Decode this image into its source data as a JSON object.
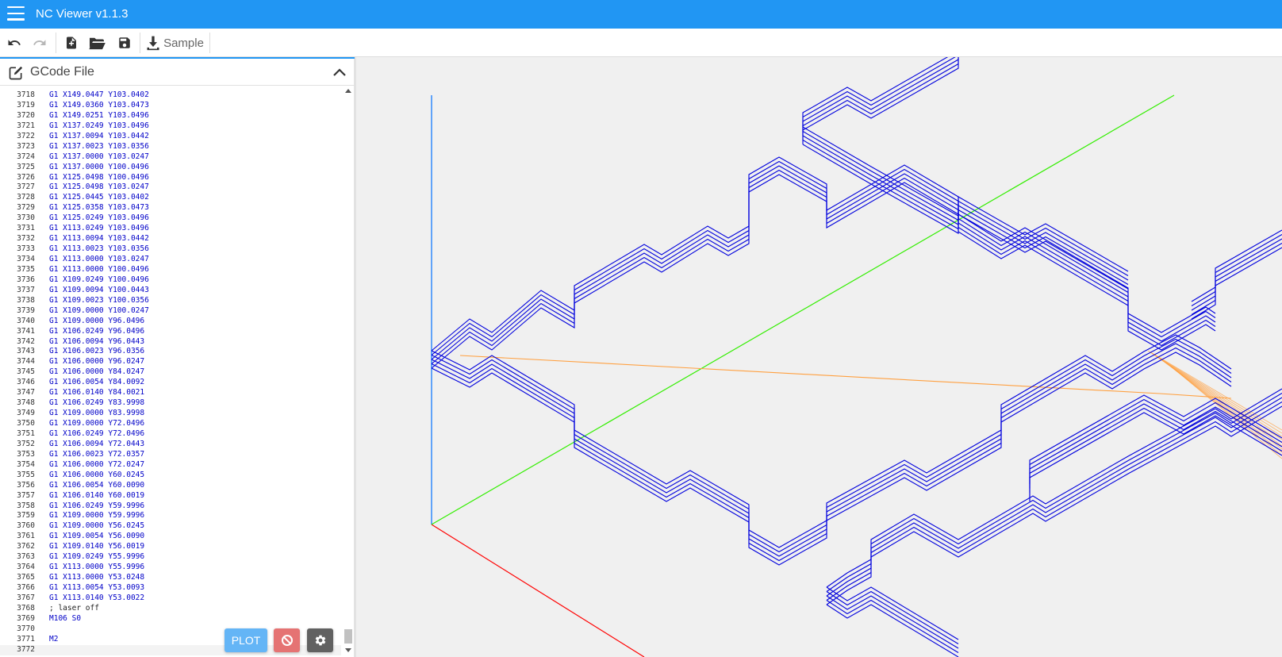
{
  "app": {
    "title": "NC Viewer  v1.1.3"
  },
  "toolbar": {
    "sample_label": "Sample",
    "icons": [
      "undo-icon",
      "redo-icon",
      "new-file-icon",
      "open-folder-icon",
      "save-icon",
      "download-icon"
    ]
  },
  "panel": {
    "title": "GCode File"
  },
  "editor": {
    "lines": [
      {
        "n": "3718",
        "code": "G1 X149.0447 Y103.0402"
      },
      {
        "n": "3719",
        "code": "G1 X149.0360 Y103.0473"
      },
      {
        "n": "3720",
        "code": "G1 X149.0251 Y103.0496"
      },
      {
        "n": "3721",
        "code": "G1 X137.0249 Y103.0496"
      },
      {
        "n": "3722",
        "code": "G1 X137.0094 Y103.0442"
      },
      {
        "n": "3723",
        "code": "G1 X137.0023 Y103.0356"
      },
      {
        "n": "3724",
        "code": "G1 X137.0000 Y103.0247"
      },
      {
        "n": "3725",
        "code": "G1 X137.0000 Y100.0496"
      },
      {
        "n": "3726",
        "code": "G1 X125.0498 Y100.0496"
      },
      {
        "n": "3727",
        "code": "G1 X125.0498 Y103.0247"
      },
      {
        "n": "3728",
        "code": "G1 X125.0445 Y103.0402"
      },
      {
        "n": "3729",
        "code": "G1 X125.0358 Y103.0473"
      },
      {
        "n": "3730",
        "code": "G1 X125.0249 Y103.0496"
      },
      {
        "n": "3731",
        "code": "G1 X113.0249 Y103.0496"
      },
      {
        "n": "3732",
        "code": "G1 X113.0094 Y103.0442"
      },
      {
        "n": "3733",
        "code": "G1 X113.0023 Y103.0356"
      },
      {
        "n": "3734",
        "code": "G1 X113.0000 Y103.0247"
      },
      {
        "n": "3735",
        "code": "G1 X113.0000 Y100.0496"
      },
      {
        "n": "3736",
        "code": "G1 X109.0249 Y100.0496"
      },
      {
        "n": "3737",
        "code": "G1 X109.0094 Y100.0443"
      },
      {
        "n": "3738",
        "code": "G1 X109.0023 Y100.0356"
      },
      {
        "n": "3739",
        "code": "G1 X109.0000 Y100.0247"
      },
      {
        "n": "3740",
        "code": "G1 X109.0000 Y96.0496"
      },
      {
        "n": "3741",
        "code": "G1 X106.0249 Y96.0496"
      },
      {
        "n": "3742",
        "code": "G1 X106.0094 Y96.0443"
      },
      {
        "n": "3743",
        "code": "G1 X106.0023 Y96.0356"
      },
      {
        "n": "3744",
        "code": "G1 X106.0000 Y96.0247"
      },
      {
        "n": "3745",
        "code": "G1 X106.0000 Y84.0247"
      },
      {
        "n": "3746",
        "code": "G1 X106.0054 Y84.0092"
      },
      {
        "n": "3747",
        "code": "G1 X106.0140 Y84.0021"
      },
      {
        "n": "3748",
        "code": "G1 X106.0249 Y83.9998"
      },
      {
        "n": "3749",
        "code": "G1 X109.0000 Y83.9998"
      },
      {
        "n": "3750",
        "code": "G1 X109.0000 Y72.0496"
      },
      {
        "n": "3751",
        "code": "G1 X106.0249 Y72.0496"
      },
      {
        "n": "3752",
        "code": "G1 X106.0094 Y72.0443"
      },
      {
        "n": "3753",
        "code": "G1 X106.0023 Y72.0357"
      },
      {
        "n": "3754",
        "code": "G1 X106.0000 Y72.0247"
      },
      {
        "n": "3755",
        "code": "G1 X106.0000 Y60.0245"
      },
      {
        "n": "3756",
        "code": "G1 X106.0054 Y60.0090"
      },
      {
        "n": "3757",
        "code": "G1 X106.0140 Y60.0019"
      },
      {
        "n": "3758",
        "code": "G1 X106.0249 Y59.9996"
      },
      {
        "n": "3759",
        "code": "G1 X109.0000 Y59.9996"
      },
      {
        "n": "3760",
        "code": "G1 X109.0000 Y56.0245"
      },
      {
        "n": "3761",
        "code": "G1 X109.0054 Y56.0090"
      },
      {
        "n": "3762",
        "code": "G1 X109.0140 Y56.0019"
      },
      {
        "n": "3763",
        "code": "G1 X109.0249 Y55.9996"
      },
      {
        "n": "3764",
        "code": "G1 X113.0000 Y55.9996"
      },
      {
        "n": "3765",
        "code": "G1 X113.0000 Y53.0248"
      },
      {
        "n": "3766",
        "code": "G1 X113.0054 Y53.0093"
      },
      {
        "n": "3767",
        "code": "G1 X113.0140 Y53.0022"
      },
      {
        "n": "3768",
        "code": "; laser off",
        "kind": "comment"
      },
      {
        "n": "3769",
        "code": "M106 S0"
      },
      {
        "n": "3770",
        "code": ""
      },
      {
        "n": "3771",
        "code": "M2"
      },
      {
        "n": "3772",
        "code": "",
        "active": true
      }
    ]
  },
  "actions": {
    "plot_label": "PLOT",
    "stop_icon": "stop-icon",
    "settings_icon": "gear-icon"
  },
  "viewport": {
    "colors": {
      "toolpath": "#0000dd",
      "axis_x": "#ff0000",
      "axis_y": "#33ee00",
      "axis_z": "#0070ff",
      "rapid": "#ffa040",
      "background": "#f0f0f0",
      "appbar": "#2196f3"
    }
  }
}
